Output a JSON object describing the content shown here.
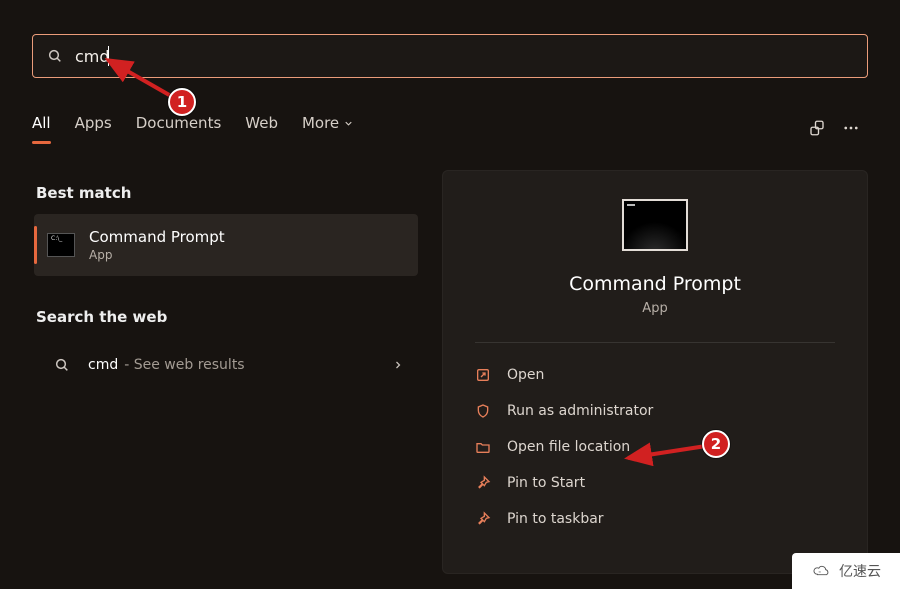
{
  "search": {
    "value": "cmd"
  },
  "tabs": {
    "all": "All",
    "apps": "Apps",
    "documents": "Documents",
    "web": "Web",
    "more": "More"
  },
  "sections": {
    "best_match": "Best match",
    "search_web": "Search the web"
  },
  "best_result": {
    "name": "Command Prompt",
    "type": "App"
  },
  "web_result": {
    "term": "cmd",
    "hint": "- See web results"
  },
  "detail": {
    "name": "Command Prompt",
    "type": "App",
    "actions": {
      "open": "Open",
      "run_admin": "Run as administrator",
      "open_location": "Open file location",
      "pin_start": "Pin to Start",
      "pin_taskbar": "Pin to taskbar"
    }
  },
  "annotations": {
    "badge1": "1",
    "badge2": "2"
  },
  "watermark": {
    "text": "亿速云"
  }
}
